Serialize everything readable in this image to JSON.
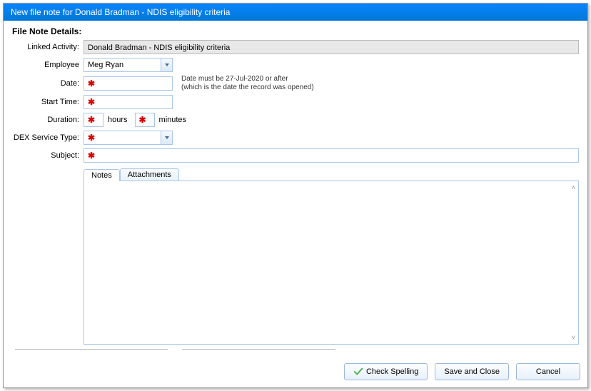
{
  "window": {
    "title": "New file note for Donald Bradman - NDIS eligibility criteria"
  },
  "section_title": "File Note Details:",
  "labels": {
    "linked_activity": "Linked Activity:",
    "employee": "Employee",
    "date": "Date:",
    "start_time": "Start Time:",
    "duration": "Duration:",
    "dex_service_type": "DEX Service Type:",
    "subject": "Subject:",
    "hours": "hours",
    "minutes": "minutes"
  },
  "fields": {
    "linked_activity_value": "Donald Bradman - NDIS eligibility criteria",
    "employee_value": "Meg Ryan",
    "date_value": "",
    "start_time_value": "",
    "duration_hours": "",
    "duration_minutes": "",
    "dex_service_type_value": "",
    "subject_value": "",
    "notes_value": ""
  },
  "hints": {
    "date_line1": "Date must be 27-Jul-2020 or after",
    "date_line2": "(which is the date the record was opened)"
  },
  "tabs": {
    "notes": "Notes",
    "attachments": "Attachments"
  },
  "buttons": {
    "check_spelling": "Check Spelling",
    "save_and_close": "Save and Close",
    "cancel": "Cancel"
  },
  "required_marker": "✱"
}
